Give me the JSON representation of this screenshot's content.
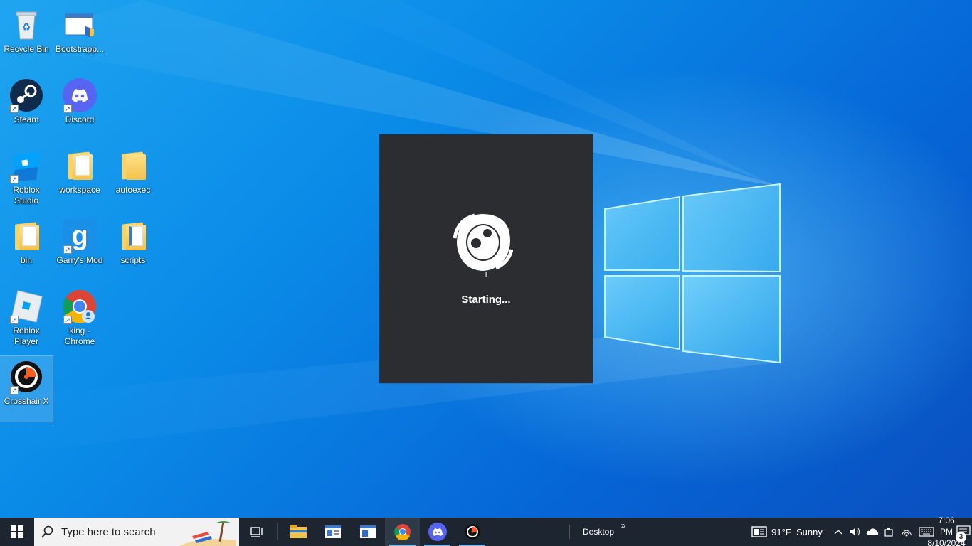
{
  "desktop": {
    "icons": [
      {
        "label": "Recycle Bin",
        "icon": "recycle-bin-icon"
      },
      {
        "label": "Bootstrapp...",
        "icon": "installer-icon"
      },
      {
        "label": "Steam",
        "icon": "steam-icon"
      },
      {
        "label": "Discord",
        "icon": "discord-icon"
      },
      {
        "label": "Roblox Studio",
        "icon": "roblox-studio-icon"
      },
      {
        "label": "workspace",
        "icon": "folder-icon"
      },
      {
        "label": "autoexec",
        "icon": "folder-icon"
      },
      {
        "label": "bin",
        "icon": "folder-icon"
      },
      {
        "label": "Garry's Mod",
        "icon": "garrys-mod-icon"
      },
      {
        "label": "scripts",
        "icon": "folder-icon"
      },
      {
        "label": "Roblox Player",
        "icon": "roblox-player-icon"
      },
      {
        "label": "king - Chrome",
        "icon": "chrome-profile-icon"
      },
      {
        "label": "Crosshair X",
        "icon": "crosshair-x-icon"
      }
    ]
  },
  "splash": {
    "status": "Starting...",
    "background": "#2b2d31"
  },
  "taskbar": {
    "search_placeholder": "Type here to search",
    "desktop_label": "Desktop",
    "chevron": "»",
    "weather": "91°F  Sunny",
    "time": "7:06 PM",
    "date": "8/10/2024",
    "notification_count": "3",
    "apps": [
      "task-view",
      "file-explorer",
      "news-app",
      "store-app",
      "chrome",
      "discord",
      "crosshair-x"
    ]
  },
  "colors": {
    "accent": "#0078d7",
    "taskbar": "#1c2530",
    "running_indicator": "#76b9ed"
  }
}
